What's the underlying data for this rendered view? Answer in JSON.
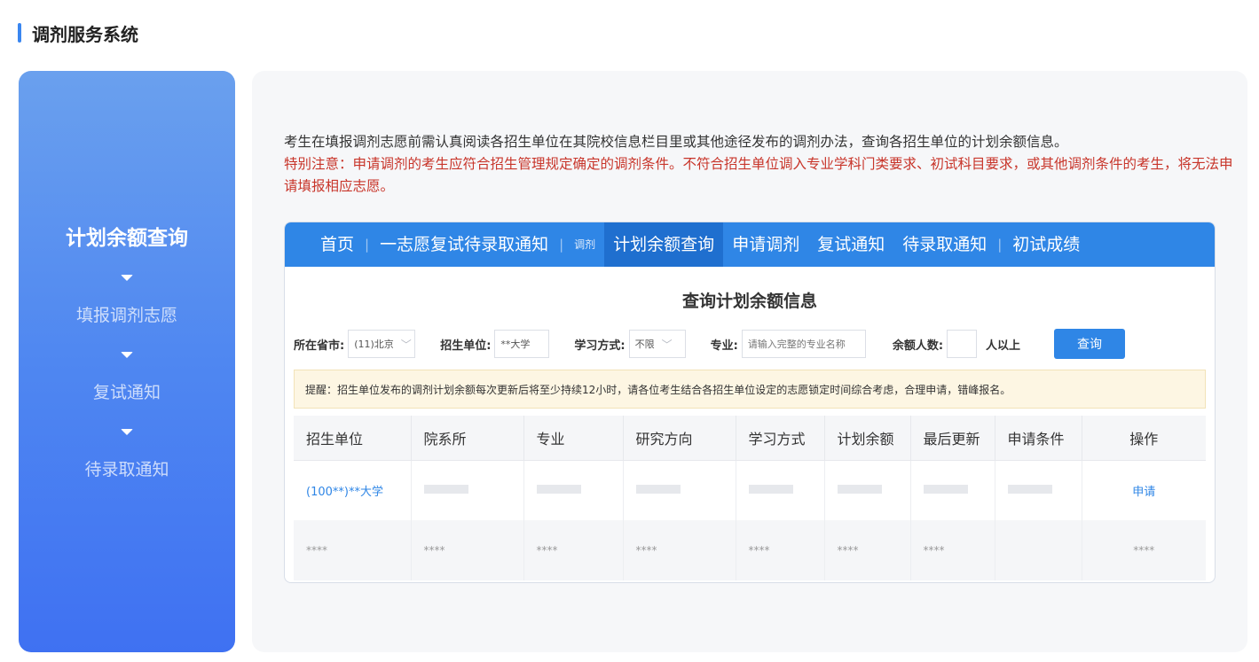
{
  "header": {
    "title": "调剂服务系统"
  },
  "sidebar": {
    "steps": [
      "计划余额查询",
      "填报调剂志愿",
      "复试通知",
      "待录取通知"
    ]
  },
  "notice": {
    "line1": "考生在填报调剂志愿前需认真阅读各招生单位在其院校信息栏目里或其他途径发布的调剂办法，查询各招生单位的计划余额信息。",
    "line2": "特别注意：申请调剂的考生应符合招生管理规定确定的调剂条件。不符合招生单位调入专业学科门类要求、初试科目要求，或其他调剂条件的考生，将无法申请填报相应志愿。"
  },
  "nav": {
    "items": [
      "首页",
      "一志愿复试待录取通知",
      "调剂",
      "计划余额查询",
      "申请调剂",
      "复试通知",
      "待录取通知",
      "初试成绩"
    ],
    "active": "计划余额查询"
  },
  "query": {
    "title": "查询计划余额信息",
    "province_label": "所在省市:",
    "province_value": "(11)北京",
    "unit_label": "招生单位:",
    "unit_value": "**大学",
    "mode_label": "学习方式:",
    "mode_value": "不限",
    "major_label": "专业:",
    "major_placeholder": "请输入完整的专业名称",
    "quota_label": "余额人数:",
    "quota_value": "",
    "quota_suffix": "人以上",
    "search_button": "查询"
  },
  "tip": "提醒：招生单位发布的调剂计划余额每次更新后将至少持续12小时，请各位考生结合各招生单位设定的志愿锁定时间综合考虑，合理申请，错峰报名。",
  "table": {
    "headers": [
      "招生单位",
      "院系所",
      "专业",
      "研究方向",
      "学习方式",
      "计划余额",
      "最后更新",
      "申请条件",
      "操作"
    ],
    "row1": {
      "unit": "(100**)**大学",
      "action": "申请"
    },
    "row2": [
      "****",
      "****",
      "****",
      "****",
      "****",
      "****",
      "****",
      "",
      "****"
    ]
  }
}
